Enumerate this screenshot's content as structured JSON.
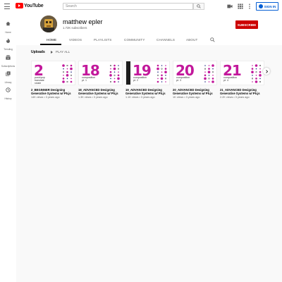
{
  "topbar": {
    "logo_text": "YouTube",
    "search_placeholder": "Search",
    "signin_label": "SIGN IN"
  },
  "sidebar": {
    "items": [
      {
        "label": "Home",
        "icon": "home-icon"
      },
      {
        "label": "Trending",
        "icon": "trending-icon"
      },
      {
        "label": "Subscriptions",
        "icon": "subscriptions-icon"
      },
      {
        "label": "Library",
        "icon": "library-icon"
      },
      {
        "label": "History",
        "icon": "history-icon"
      }
    ]
  },
  "channel": {
    "name": "matthew epler",
    "subscribers": "1.72K subscribers",
    "subscribe_label": "SUBSCRIBE"
  },
  "tabs": [
    {
      "label": "HOME",
      "active": true
    },
    {
      "label": "VIDEOS",
      "active": false
    },
    {
      "label": "PLAYLISTS",
      "active": false
    },
    {
      "label": "COMMUNITY",
      "active": false
    },
    {
      "label": "CHANNELS",
      "active": false
    },
    {
      "label": "ABOUT",
      "active": false
    }
  ],
  "uploads": {
    "title": "Uploads",
    "play_all": "PLAY ALL",
    "videos": [
      {
        "thumb_number": "2",
        "thumb_sub": "push/pop\ntranslate\nrotate",
        "title": "2_BEGINNER Designing Generative Systems w/ P5.js",
        "meta": "14K views • 3 years ago"
      },
      {
        "thumb_number": "18",
        "thumb_sub": "composition\npt. 1",
        "title": "18_ADVANCED Designing Generative Systems w/ P5.js",
        "meta": "1.3K views • 3 years ago"
      },
      {
        "thumb_number": "19",
        "thumb_sub": "composition\npt. 2",
        "title": "19_ADVANCED Designing Generative Systems w/ P5.js",
        "meta": "1.1K views • 3 years ago"
      },
      {
        "thumb_number": "20",
        "thumb_sub": "composition\npt. 3",
        "title": "20_ADVANCED Designing Generative Systems w/ P5.js",
        "meta": "1K views • 3 years ago"
      },
      {
        "thumb_number": "21",
        "thumb_sub": "composition\npt. 4",
        "title": "21_ADVANCED Designing Generative Systems w/ P5.js",
        "meta": "2.2K views • 3 years ago"
      }
    ]
  },
  "colors": {
    "brand_red": "#ff0000",
    "subscribe_red": "#cc0000",
    "link_blue": "#065fd4",
    "thumb_magenta": "#c2189b"
  }
}
